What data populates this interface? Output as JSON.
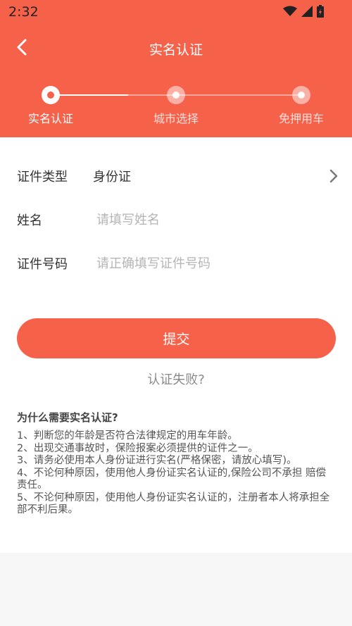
{
  "status_bar": {
    "time": "2:32"
  },
  "nav": {
    "title": "实名认证"
  },
  "steps": [
    {
      "label": "实名认证",
      "state": "active"
    },
    {
      "label": "城市选择",
      "state": "inactive"
    },
    {
      "label": "免押用车",
      "state": "inactive"
    }
  ],
  "form": {
    "id_type": {
      "label": "证件类型",
      "value": "身份证"
    },
    "name": {
      "label": "姓名",
      "placeholder": "请填写姓名"
    },
    "id_number": {
      "label": "证件号码",
      "placeholder": "请正确填写证件号码"
    }
  },
  "submit_label": "提交",
  "fail_link": "认证失败?",
  "notice": {
    "title": "为什么需要实名认证?",
    "items": [
      "1、判断您的年龄是否符合法律规定的用车年龄。",
      " 2、出现交通事故时，保险报案必须提供的证件之一。",
      " 3、请务必使用本人身份证进行实名(严格保密，请放心填写)。",
      " 4、不论何种原因，使用他人身份证实名认证的,保险公司不承担 赔偿责任。",
      " 5、不论何种原因，使用他人身份证实名认证的，注册者本人将承担全部不利后果。"
    ]
  },
  "colors": {
    "accent": "#f6614a",
    "background": "#f7f7f7"
  }
}
